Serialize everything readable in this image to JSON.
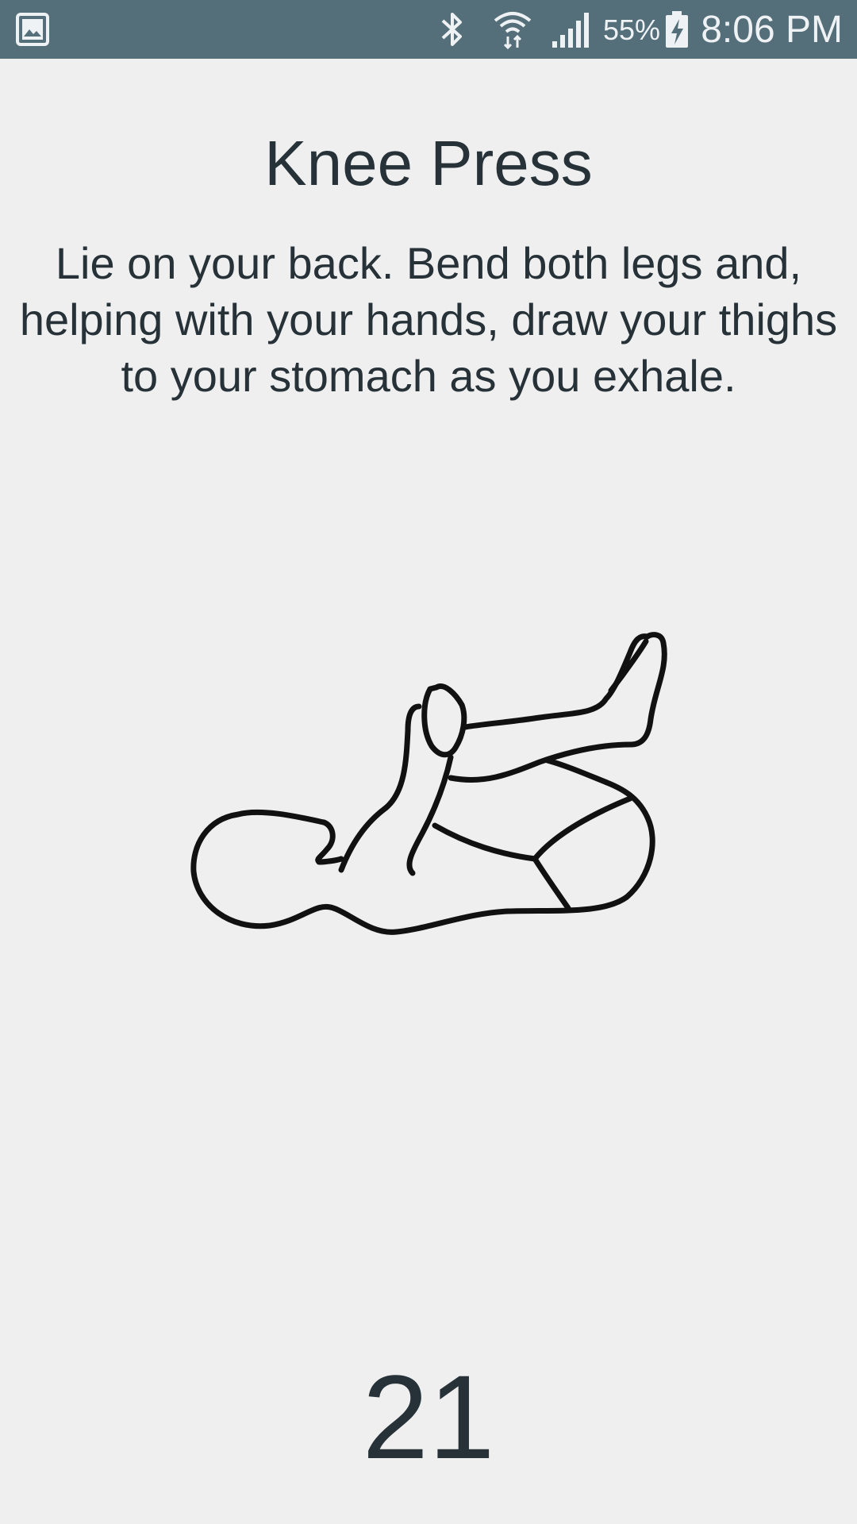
{
  "status_bar": {
    "notification_icon": "image-icon",
    "bluetooth_icon": "bluetooth-icon",
    "wifi_icon": "wifi-icon",
    "signal_icon": "signal-icon",
    "battery_percent": "55%",
    "battery_icon": "battery-charging-icon",
    "time": "8:06 PM",
    "background_color": "#546e7a"
  },
  "exercise": {
    "title": "Knee Press",
    "description": "Lie on your back. Bend both legs and, helping with your hands, draw your thighs to your stomach as you exhale.",
    "illustration_icon": "knee-press-figure",
    "counter": "21"
  },
  "colors": {
    "background": "#efefef",
    "text": "#263238"
  }
}
